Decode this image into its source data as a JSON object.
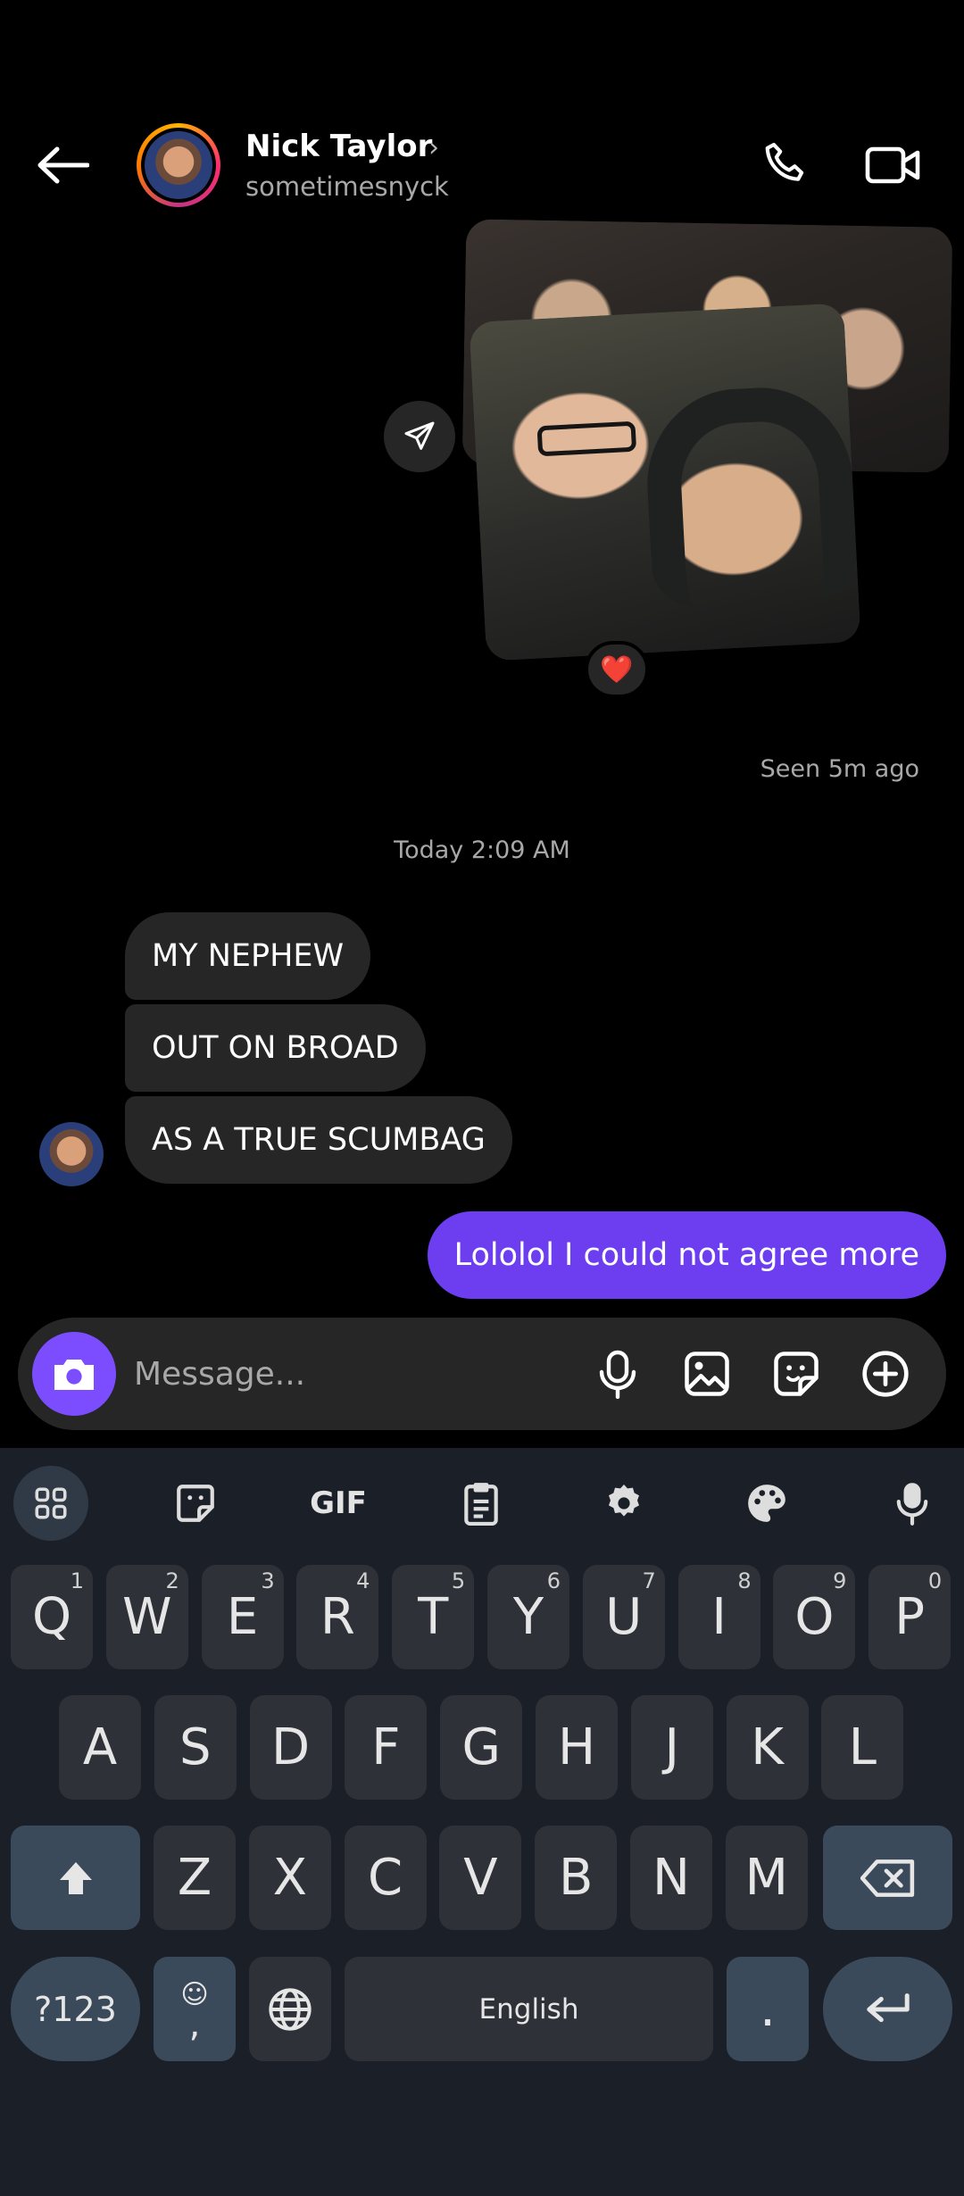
{
  "contact": {
    "name": "Nick Taylor",
    "username": "sometimesnyck"
  },
  "photo_reaction": "❤️",
  "seen_text": "Seen 5m ago",
  "timestamp": "Today 2:09 AM",
  "messages_in": [
    "MY NEPHEW",
    "OUT ON BROAD",
    "AS A TRUE SCUMBAG"
  ],
  "message_out": "Lololol I could not agree more",
  "composer": {
    "placeholder": "Message..."
  },
  "keyboard": {
    "toolbar_gif": "GIF",
    "row1": [
      {
        "k": "Q",
        "n": "1"
      },
      {
        "k": "W",
        "n": "2"
      },
      {
        "k": "E",
        "n": "3"
      },
      {
        "k": "R",
        "n": "4"
      },
      {
        "k": "T",
        "n": "5"
      },
      {
        "k": "Y",
        "n": "6"
      },
      {
        "k": "U",
        "n": "7"
      },
      {
        "k": "I",
        "n": "8"
      },
      {
        "k": "O",
        "n": "9"
      },
      {
        "k": "P",
        "n": "0"
      }
    ],
    "row2": [
      "A",
      "S",
      "D",
      "F",
      "G",
      "H",
      "J",
      "K",
      "L"
    ],
    "row3": [
      "Z",
      "X",
      "C",
      "V",
      "B",
      "N",
      "M"
    ],
    "symbols": "?123",
    "comma": ",",
    "space": "English",
    "period": "."
  }
}
